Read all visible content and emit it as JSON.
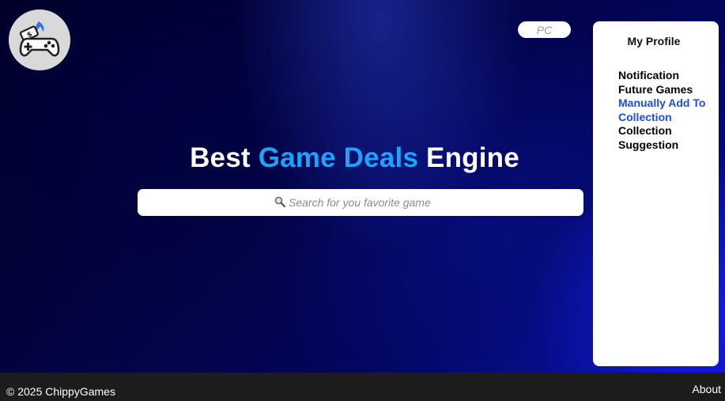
{
  "header": {
    "logo_icon": "gamepad-price-tag-flame-icon",
    "platform_label": "PC"
  },
  "hero": {
    "headline_prefix": "Best",
    "headline_accent": "Game Deals",
    "headline_suffix": "Engine",
    "accent_color": "#1aa3ff"
  },
  "search": {
    "icon": "magnifier-icon",
    "placeholder": "Search for you favorite game",
    "value": ""
  },
  "profile_menu": {
    "title": "My Profile",
    "items": [
      {
        "label": "Notification",
        "active": false
      },
      {
        "label": "Future Games",
        "active": false
      },
      {
        "label": "Manually Add To Collection",
        "active": true
      },
      {
        "label": "Collection",
        "active": false
      },
      {
        "label": "Suggestion",
        "active": false
      }
    ],
    "active_color": "#1a4fd6"
  },
  "footer": {
    "copyright": "© 2025 ChippyGames",
    "about_label": "About"
  }
}
